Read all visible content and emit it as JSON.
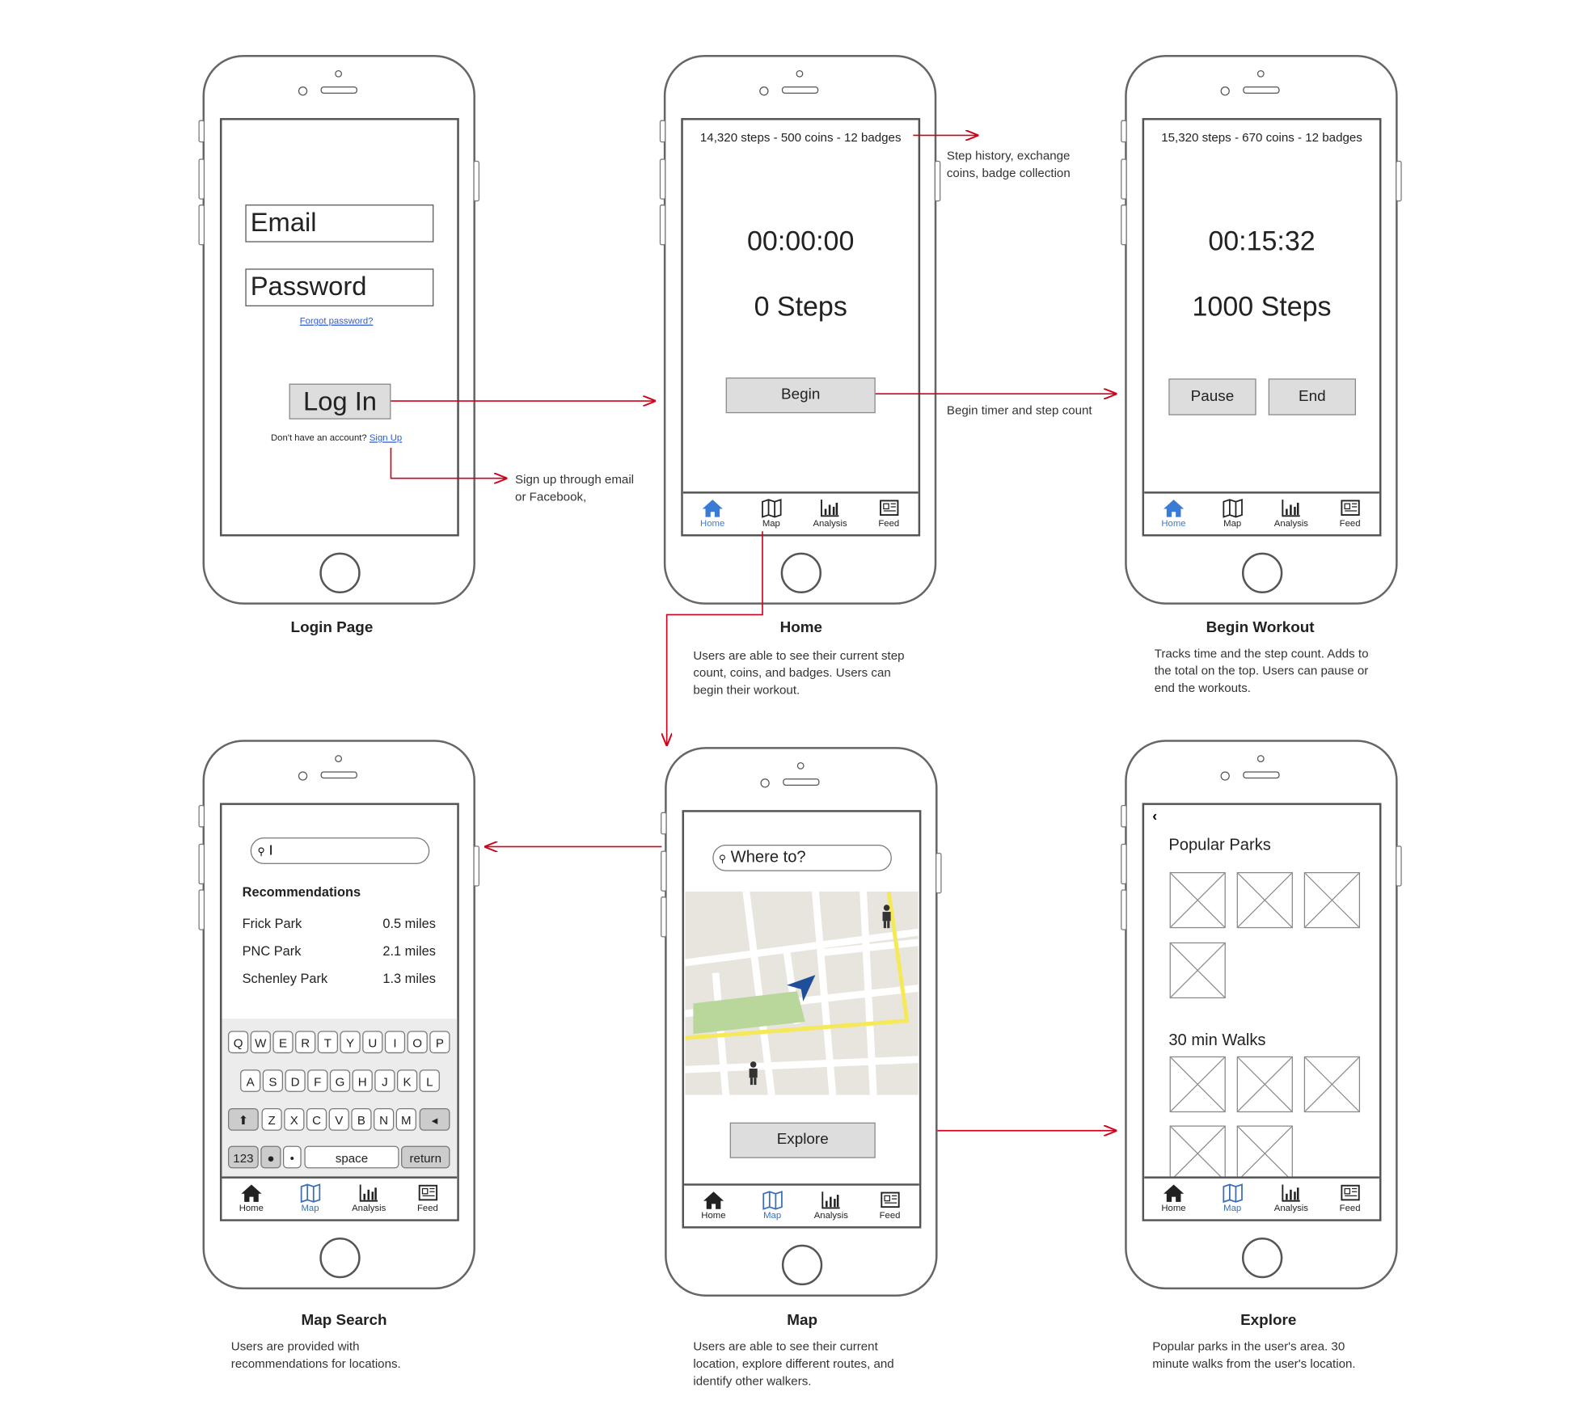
{
  "tabs": [
    {
      "id": "home",
      "label": "Home"
    },
    {
      "id": "map",
      "label": "Map"
    },
    {
      "id": "analysis",
      "label": "Analysis"
    },
    {
      "id": "feed",
      "label": "Feed"
    }
  ],
  "colors": {
    "accent": "#3a7bd5",
    "arrow": "#d0021b"
  },
  "login": {
    "email": "Email",
    "password": "Password",
    "forgot": "Forgot password?",
    "login_btn": "Log In",
    "no_account": "Don't have an account?",
    "signup": "Sign Up",
    "caption": "Login Page"
  },
  "home": {
    "stats": "14,320 steps - 500 coins - 12 badges",
    "timer": "00:00:00",
    "steps": "0 Steps",
    "begin": "Begin",
    "caption": "Home",
    "desc": "Users are able to see their current step count, coins, and badges. Users can begin their workout."
  },
  "workout": {
    "stats": "15,320 steps - 670 coins - 12 badges",
    "timer": "00:15:32",
    "steps": "1000 Steps",
    "pause": "Pause",
    "end": "End",
    "caption": "Begin Workout",
    "desc": "Tracks time and the step count. Adds to the total on the top. Users can pause or end the workouts."
  },
  "notes": {
    "signup": "Sign up through email or Facebook,",
    "stats": "Step history, exchange coins, badge collection",
    "begin": "Begin timer and step count"
  },
  "mapsearch": {
    "query": "I",
    "heading": "Recommendations",
    "items": [
      {
        "name": "Frick Park",
        "dist": "0.5 miles"
      },
      {
        "name": "PNC Park",
        "dist": "2.1 miles"
      },
      {
        "name": "Schenley Park",
        "dist": "1.3 miles"
      }
    ],
    "keys": {
      "row1": [
        "Q",
        "W",
        "E",
        "R",
        "T",
        "Y",
        "U",
        "I",
        "O",
        "P"
      ],
      "row2": [
        "A",
        "S",
        "D",
        "F",
        "G",
        "H",
        "J",
        "K",
        "L"
      ],
      "row3": [
        "Z",
        "X",
        "C",
        "V",
        "B",
        "N",
        "M"
      ],
      "num": "123",
      "space": "space",
      "return": "return"
    },
    "caption": "Map Search",
    "desc": "Users are provided with recommendations for locations."
  },
  "map": {
    "placeholder": "Where to?",
    "explore": "Explore",
    "caption": "Map",
    "desc": "Users are able to see their current location, explore different routes, and identify other walkers."
  },
  "explore": {
    "section1": "Popular Parks",
    "section2": "30 min Walks",
    "caption": "Explore",
    "desc": "Popular parks in the user's area. 30 minute walks from the user's location."
  }
}
